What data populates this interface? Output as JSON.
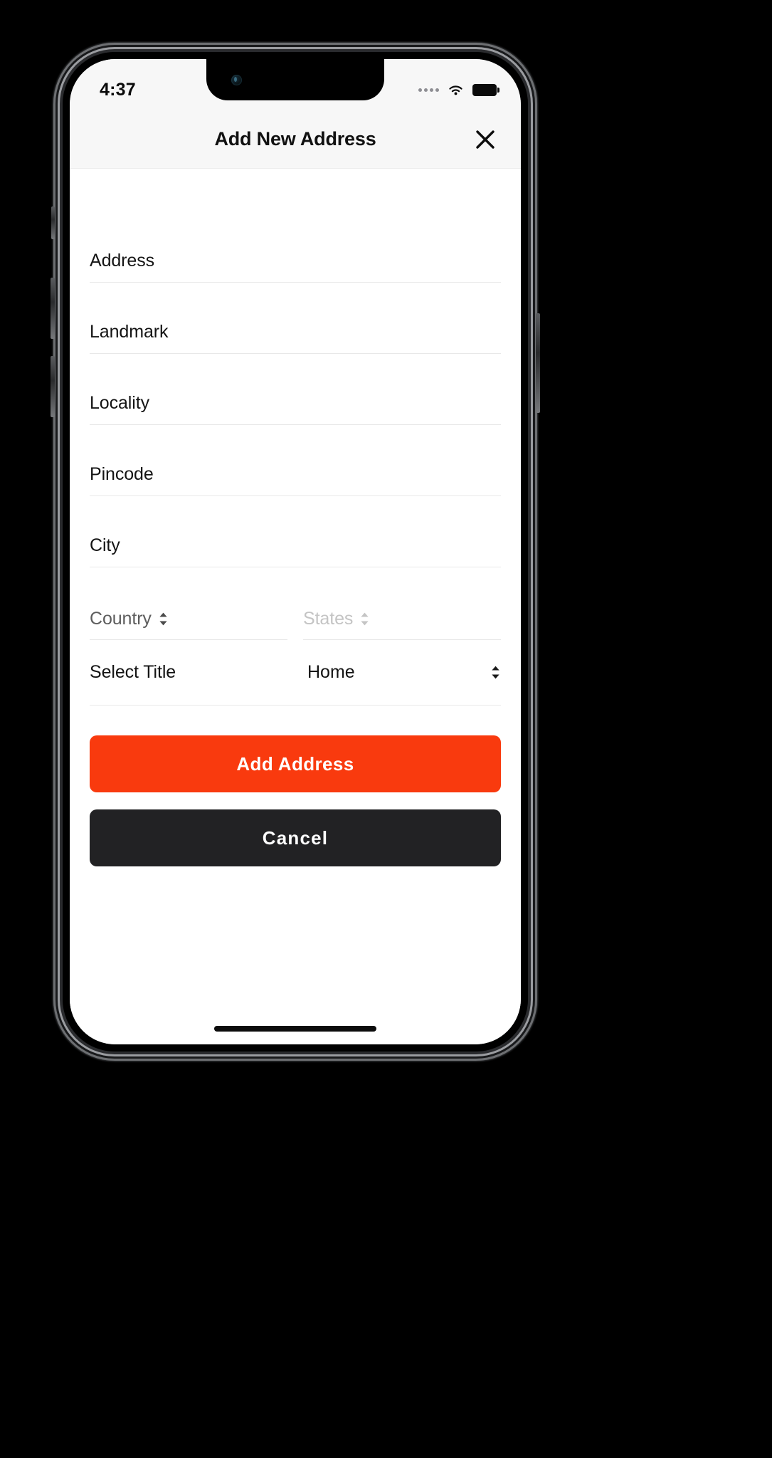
{
  "status_bar": {
    "time": "4:37",
    "signal_icon": "signal-dots-icon",
    "wifi_icon": "wifi-icon",
    "battery_icon": "battery-full-icon"
  },
  "header": {
    "title": "Add New Address",
    "close_icon": "close-x-icon"
  },
  "form": {
    "fields": [
      {
        "label": "Address",
        "value": "",
        "type": "textarea"
      },
      {
        "label": "Landmark",
        "value": "",
        "type": "text"
      },
      {
        "label": "Locality",
        "value": "",
        "type": "text"
      },
      {
        "label": "Pincode",
        "value": "",
        "type": "text"
      },
      {
        "label": "City",
        "value": "",
        "type": "text"
      }
    ],
    "selects": {
      "country": {
        "label": "Country",
        "state": "filled",
        "icon": "chevron-up-down-icon"
      },
      "states": {
        "label": "States",
        "state": "placeholder",
        "icon": "chevron-up-down-icon"
      }
    },
    "title_row": {
      "label": "Select Title",
      "value": "Home",
      "icon": "chevron-up-down-icon"
    }
  },
  "actions": {
    "primary_label": "Add Address",
    "secondary_label": "Cancel"
  },
  "colors": {
    "accent": "#f93a0e",
    "dark": "#222224",
    "header_bg": "#f7f7f7",
    "divider": "#e8e8e8",
    "placeholder": "#c4c4c4",
    "select_text": "#5d5d5d"
  }
}
